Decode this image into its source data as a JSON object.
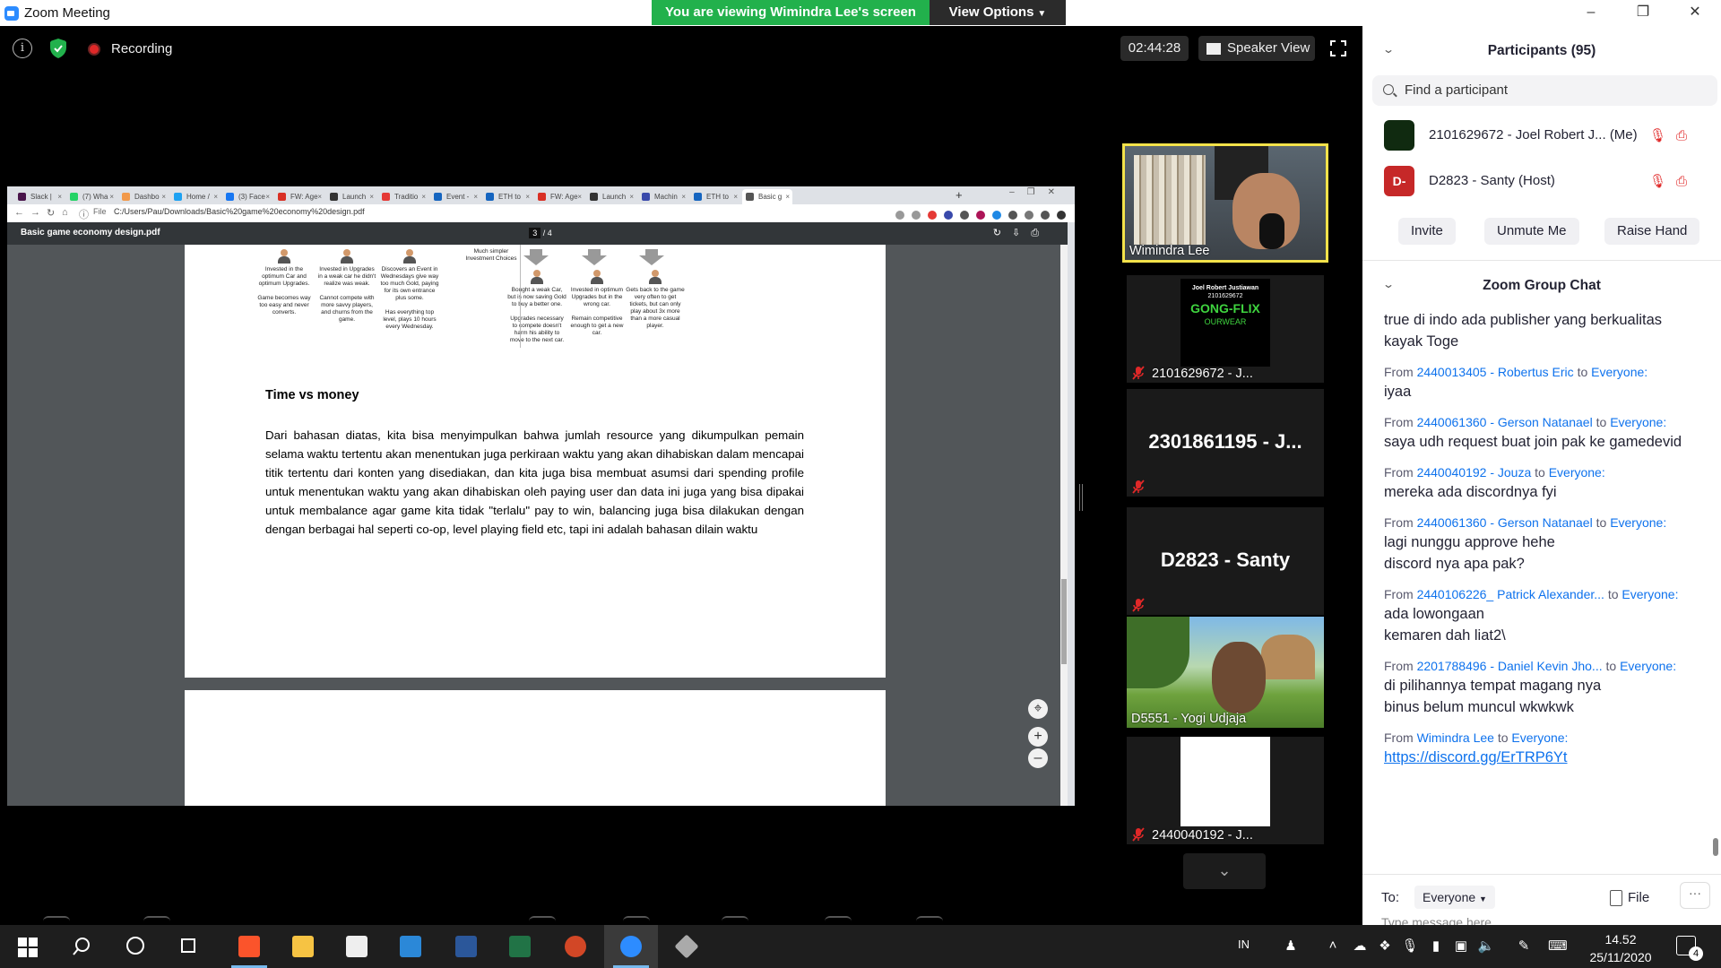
{
  "window": {
    "title": "Zoom Meeting",
    "viewing_banner": "You are viewing Wimindra Lee's screen",
    "view_options": "View Options"
  },
  "meeting": {
    "recording_label": "Recording",
    "timer": "02:44:28",
    "speaker_view": "Speaker View"
  },
  "browser": {
    "tabs": [
      {
        "label": "Slack |",
        "color": "#4a154b"
      },
      {
        "label": "(7) Wha",
        "color": "#25d366"
      },
      {
        "label": "Dashbo",
        "color": "#f2994a"
      },
      {
        "label": "Home /",
        "color": "#1da1f2"
      },
      {
        "label": "(3) Face",
        "color": "#1877f2"
      },
      {
        "label": "FW: Age",
        "color": "#d93025"
      },
      {
        "label": "Launch",
        "color": "#333333"
      },
      {
        "label": "Traditio",
        "color": "#e53935"
      },
      {
        "label": "Event -",
        "color": "#1565c0"
      },
      {
        "label": "ETH to",
        "color": "#1565c0"
      },
      {
        "label": "FW: Age",
        "color": "#d93025"
      },
      {
        "label": "Launch",
        "color": "#333333"
      },
      {
        "label": "Machin",
        "color": "#3949ab"
      },
      {
        "label": "ETH to",
        "color": "#1565c0"
      },
      {
        "label": "Basic g",
        "color": "#555555"
      }
    ],
    "new_tab": "+",
    "url_scheme": "File",
    "url": "C:/Users/Pau/Downloads/Basic%20game%20economy%20design.pdf"
  },
  "pdf": {
    "title": "Basic game economy design.pdf",
    "page_current": "3",
    "page_total": "/ 4",
    "diagram": {
      "left_figures": [
        [
          "Invested in the optimum Car and optimum Upgrades.",
          "Game becomes way too easy and never converts."
        ],
        [
          "Invested in Upgrades in a weak car he didn't realize was weak.",
          "Cannot compete with more savvy players, and churns from the game."
        ],
        [
          "Discovers an Event in Wednesdays give way too much Gold, paying for its own entrance plus some.",
          "Has everything top level, plays 10 hours every Wednesday."
        ]
      ],
      "right_caption": "Much simpler Investment Choices",
      "right_figures": [
        [
          "Bought a weak Car, but is now saving Gold to buy a better one.",
          "Upgrades necessary to compete doesn't harm his ability to move to the next car."
        ],
        [
          "Invested in optimum Upgrades but in the wrong car.",
          "Remain competitive enough to get a new car."
        ],
        [
          "Gets back to the game very often to get tickets, but can only play about 3x more than a more casual player."
        ]
      ]
    },
    "heading": "Time vs money",
    "body": "Dari bahasan diatas, kita bisa menyimpulkan bahwa jumlah resource yang dikumpulkan pemain selama waktu tertentu akan menentukan juga perkiraan waktu yang akan dihabiskan dalam mencapai titik tertentu dari konten yang disediakan, dan kita juga bisa membuat asumsi dari spending profile untuk menentukan waktu yang akan dihabiskan oleh paying user dan data ini juga yang bisa dipakai untuk membalance agar game kita tidak \"terlalu\" pay to win, balancing juga bisa dilakukan dengan dengan berbagai hal seperti co-op, level playing field etc, tapi ini adalah bahasan dilain waktu"
  },
  "gallery": {
    "tiles": [
      {
        "name": "Wimindra Lee"
      },
      {
        "name": "2101629672 - J..."
      },
      {
        "name": "2301861195 - J..."
      },
      {
        "name": "D2823 - Santy"
      },
      {
        "name": "D5551 - Yogi Udjaja"
      },
      {
        "name": "2440040192 - J..."
      }
    ],
    "gong_poster": {
      "line1": "Joel Robert Justiawan",
      "line2": "2101629672",
      "brand": "GONG-FLIX",
      "footer": "OURWEAR"
    }
  },
  "participants": {
    "header": "Participants (95)",
    "search_placeholder": "Find a participant",
    "list": [
      {
        "name": "2101629672 - Joel Robert J...",
        "tag": "(Me)"
      },
      {
        "name": "D2823 - Santy (Host)",
        "initials": "D-"
      }
    ],
    "buttons": {
      "invite": "Invite",
      "unmute": "Unmute Me",
      "raise_hand": "Raise Hand"
    }
  },
  "chat": {
    "header": "Zoom Group Chat",
    "first_text": "true di indo ada publisher yang berkualitas kayak Toge",
    "from_word": "From",
    "to_word": "to",
    "messages": [
      {
        "sender": "2440013405 - Robertus Eric",
        "to": "Everyone:",
        "text": "iyaa"
      },
      {
        "sender": "2440061360 - Gerson Natanael",
        "to": "Everyone:",
        "text": "saya udh request buat join pak ke gamedevid"
      },
      {
        "sender": "2440040192 - Jouza",
        "to": "Everyone:",
        "text": "mereka ada discordnya fyi"
      },
      {
        "sender": "2440061360 - Gerson Natanael",
        "to": "Everyone:",
        "text": "lagi nunggu approve hehe\ndiscord nya apa pak?"
      },
      {
        "sender": "2440106226_ Patrick Alexander...",
        "to": "Everyone:",
        "text": "ada lowongaan\nkemaren dah liat2\\"
      },
      {
        "sender": "2201788496 - Daniel Kevin Jho...",
        "to": "Everyone:",
        "text": "di pilihannya tempat magang nya\nbinus belum muncul wkwkwk"
      },
      {
        "sender": "Wimindra Lee",
        "to": "Everyone:",
        "link": "https://discord.gg/ErTRP6Yt"
      }
    ],
    "to_label": "To:",
    "to_value": "Everyone",
    "file_label": "File",
    "input_placeholder": "Type message here..."
  },
  "taskbar": {
    "ime": "IN",
    "time": "14.52",
    "date": "25/11/2020",
    "notifications": "4"
  }
}
